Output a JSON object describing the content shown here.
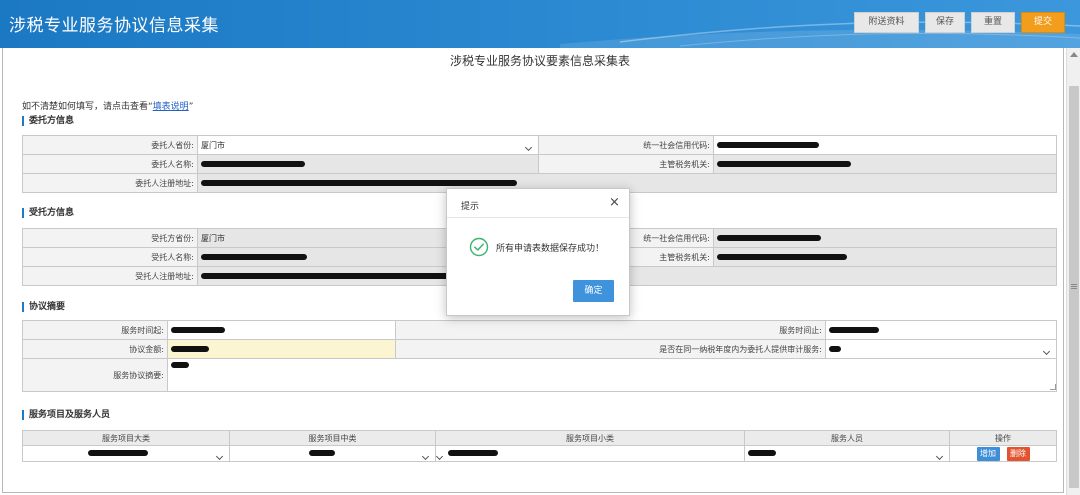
{
  "header": {
    "title": "涉税专业服务协议信息采集",
    "buttons": {
      "attach": "附送资料",
      "save": "保存",
      "reset": "重置",
      "submit": "提交"
    }
  },
  "form": {
    "title": "涉税专业服务协议要素信息采集表",
    "hint_prefix": "如不清楚如何填写，请点击查看“",
    "hint_link": "填表说明",
    "hint_suffix": "”"
  },
  "principal": {
    "section_title": "委托方信息",
    "province_label": "委托人省份:",
    "province_value": "厦门市",
    "credit_code_label": "统一社会信用代码:",
    "name_label": "委托人名称:",
    "tax_authority_label": "主管税务机关:",
    "address_label": "委托人注册地址:"
  },
  "agent": {
    "section_title": "受托方信息",
    "province_label": "受托方省份:",
    "province_value": "厦门市",
    "credit_code_label": "统一社会信用代码:",
    "name_label": "受托人名称:",
    "tax_authority_label": "主管税务机关:",
    "address_label": "受托人注册地址:"
  },
  "agreement": {
    "section_title": "协议摘要",
    "start_label": "服务时间起:",
    "end_label": "服务时间止:",
    "amount_label": "协议金额:",
    "audit_label": "是否在同一纳税年度内为委托人提供审计服务:",
    "summary_label": "服务协议摘要:"
  },
  "services": {
    "section_title": "服务项目及服务人员",
    "columns": [
      "服务项目大类",
      "服务项目中类",
      "服务项目小类",
      "服务人员",
      "操作"
    ],
    "add_label": "增加",
    "delete_label": "删除"
  },
  "modal": {
    "title": "提示",
    "close": "×",
    "message": "所有申请表数据保存成功！",
    "ok": "确定"
  },
  "colors": {
    "header_blue": "#1b78c3",
    "submit_orange": "#f29d1c",
    "ok_blue": "#3f93dd",
    "delete_red": "#e1542f",
    "success_green": "#3cb371"
  }
}
